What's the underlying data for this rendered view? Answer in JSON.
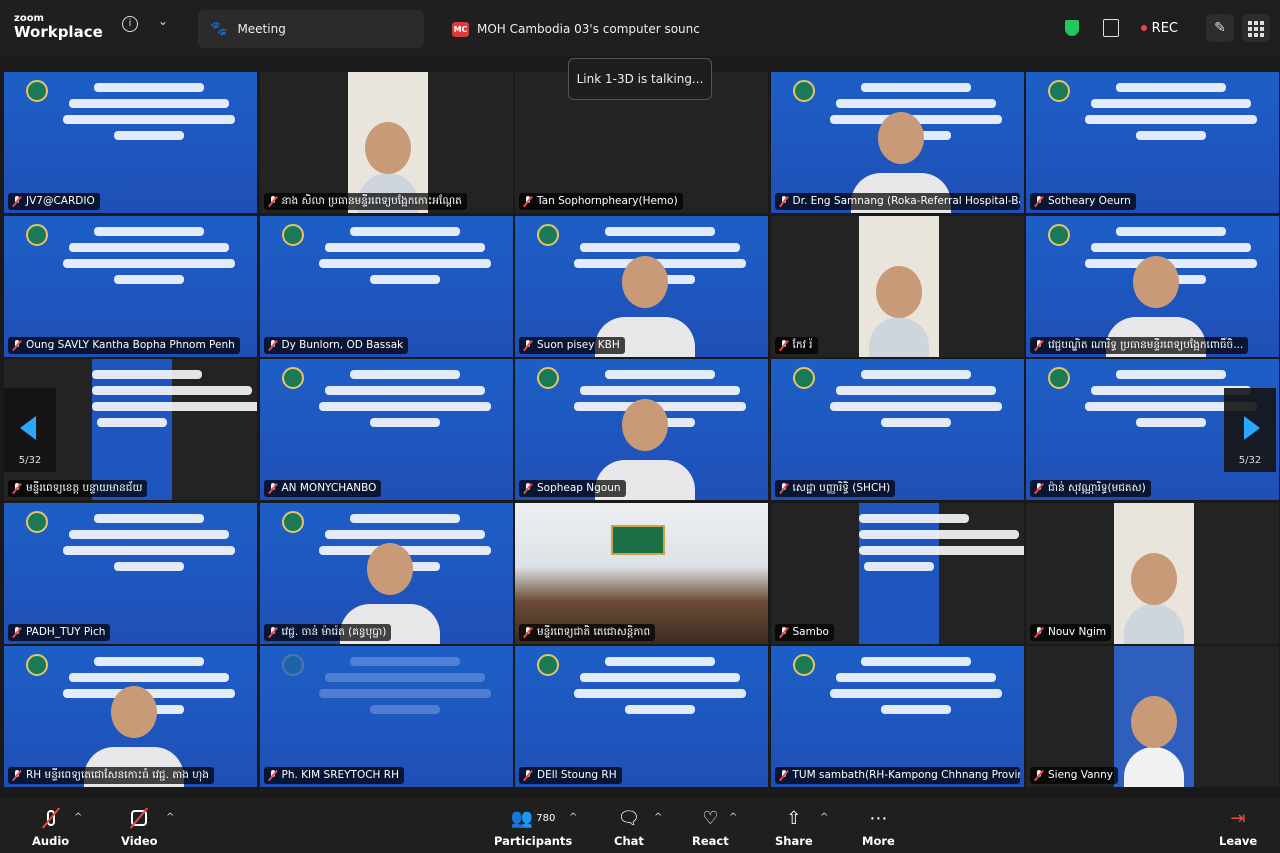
{
  "app": {
    "brand_line1": "zoom",
    "brand_line2": "Workplace"
  },
  "tabs": {
    "meeting_label": "Meeting",
    "share_badge": "MC",
    "share_label": "MOH Cambodia 03's computer sounc"
  },
  "topbar": {
    "rec_label": "REC"
  },
  "toast": {
    "talking": "Link 1-3D is talking..."
  },
  "pagination": {
    "left": "5/32",
    "right": "5/32"
  },
  "colors": {
    "accent": "#2aa7ff",
    "rec": "#ef4444",
    "secure": "#22c55e",
    "muted_mic": "#e5484d",
    "slide_blue": "#1f55bf"
  },
  "participants": [
    {
      "name": "JV7@CARDIO",
      "muted": true
    },
    {
      "name": "នាង សិលា ប្រធានមន្ទីរពេទ្យបង្អែកកោះអណ្ដែត",
      "muted": true
    },
    {
      "name": "Tan Sophornpheary(Hemo)",
      "muted": true
    },
    {
      "name": "Dr. Eng Samnang (Roka-Referral Hospital-Ba...",
      "muted": true
    },
    {
      "name": "Sotheary Oeurn",
      "muted": true
    },
    {
      "name": "Oung SAVLY Kantha Bopha Phnom Penh",
      "muted": true
    },
    {
      "name": "Dy Bunlorn, OD Bassak",
      "muted": true
    },
    {
      "name": "Suon pisey KBH",
      "muted": true
    },
    {
      "name": "កែវ រ៉",
      "muted": true
    },
    {
      "name": "វេជ្ជបណ្ឌិត ណារិទ្ធ ប្រធានមន្ទីរពេទ្យបង្អែកពោធិ៍ចិ...",
      "muted": true
    },
    {
      "name": "មន្ទីរពេទ្យខេត្ត បន្ទាយមានជ័យ",
      "muted": true
    },
    {
      "name": "AN MONYCHANBO",
      "muted": true
    },
    {
      "name": "Sopheap Ngoun",
      "muted": true
    },
    {
      "name": "សេដ្ឋា បញ្ញារិទ្ធិ (SHCH)",
      "muted": true
    },
    {
      "name": "ជ៉ាន់ សុវណ្ណារិទ្ធ(មជតស)",
      "muted": true
    },
    {
      "name": "PADH_TUY Pich",
      "muted": true
    },
    {
      "name": "វេជ្ជ. ចាន់ ម៉ារ៉េត (គន្ធបុប្ផា)",
      "muted": true
    },
    {
      "name": "មន្ទីរពេទ្យជាតិ តេជោសន្តិភាព",
      "muted": true
    },
    {
      "name": "Sambo",
      "muted": true
    },
    {
      "name": "Nouv Ngim",
      "muted": true
    },
    {
      "name": "RH មន្ទីរពេទ្យតេជោសែនកោះធំ វេជ្ជ. តាង ហុង",
      "muted": true
    },
    {
      "name": "Ph. KIM SREYTOCH RH",
      "muted": true
    },
    {
      "name": "DEll Stoung RH",
      "muted": true
    },
    {
      "name": "TUM sambath(RH-Kampong Chhnang Provin...",
      "muted": true
    },
    {
      "name": "Sieng Vanny",
      "muted": true
    }
  ],
  "toolbar": {
    "audio": "Audio",
    "video": "Video",
    "participants": "Participants",
    "participants_count": "780",
    "chat": "Chat",
    "react": "React",
    "share": "Share",
    "more": "More",
    "leave": "Leave"
  }
}
